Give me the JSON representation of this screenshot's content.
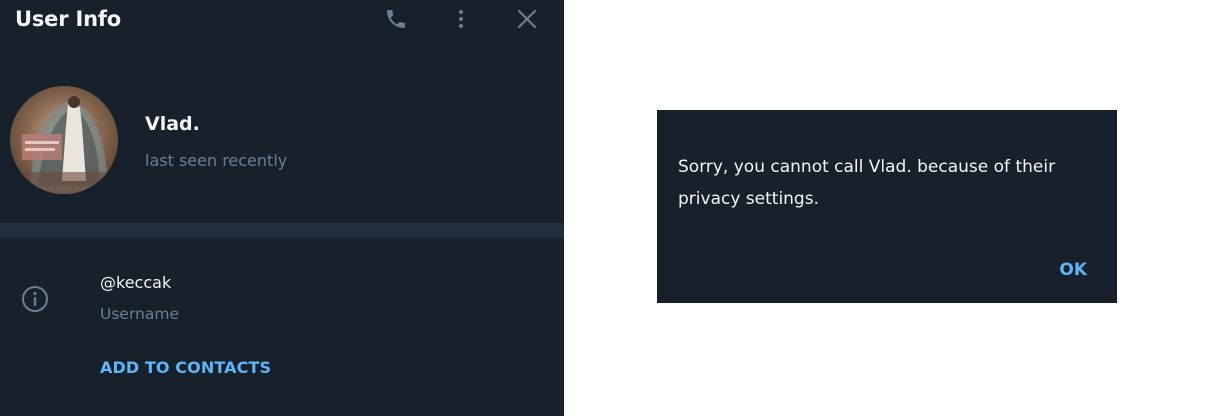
{
  "panel": {
    "title": "User Info",
    "header_icons": [
      "phone-icon",
      "more-vertical-icon",
      "close-icon"
    ],
    "profile": {
      "name": "Vlad.",
      "status": "last seen recently"
    },
    "info": {
      "username": "@keccak",
      "username_label": "Username",
      "add_contacts": "ADD TO CONTACTS"
    }
  },
  "dialog": {
    "message": "Sorry, you cannot call Vlad. because of their privacy settings.",
    "ok_label": "OK"
  },
  "colors": {
    "panel_bg": "#17212b",
    "divider": "#232e3c",
    "text_primary": "#f5f5f5",
    "text_secondary": "#6d7f8f",
    "accent": "#5eb5f7",
    "icon": "#6d7f8f"
  }
}
